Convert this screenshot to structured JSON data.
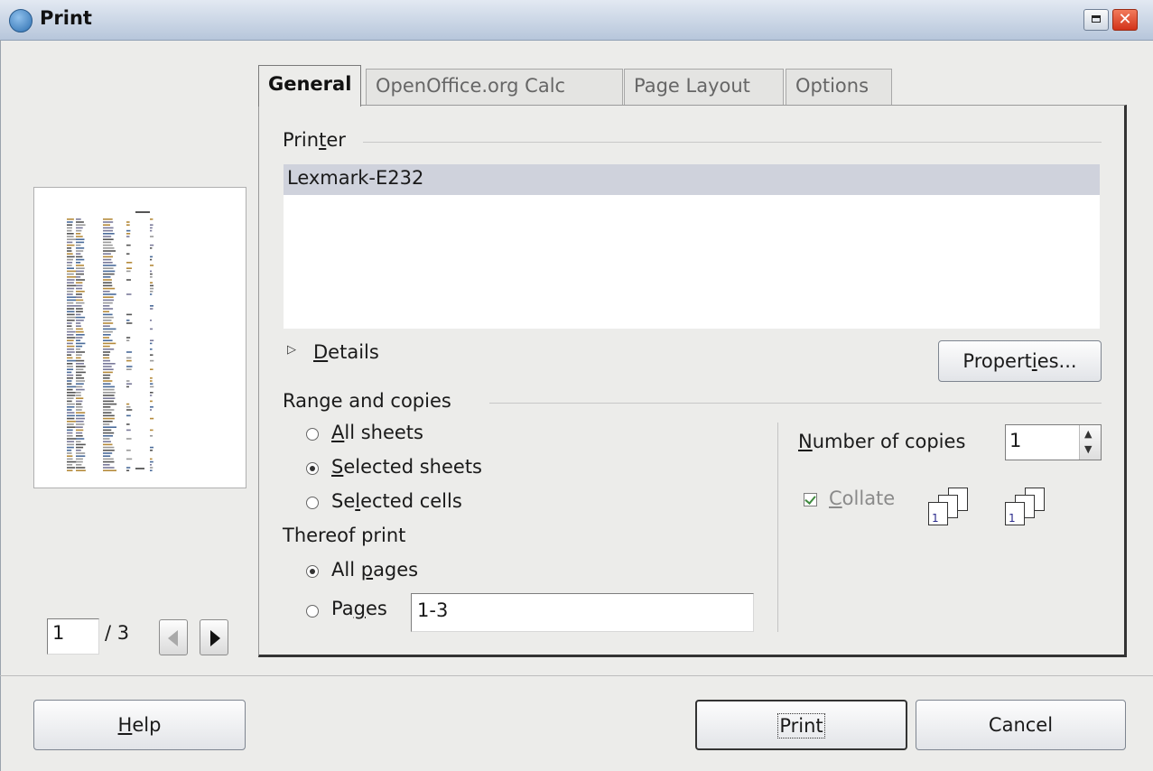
{
  "window": {
    "title": "Print"
  },
  "preview": {
    "current_page": "1",
    "total_pages": "/ 3"
  },
  "tabs": [
    {
      "label": "General",
      "active": true
    },
    {
      "label": "OpenOffice.org Calc",
      "active": false
    },
    {
      "label": "Page Layout",
      "active": false
    },
    {
      "label": "Options",
      "active": false
    }
  ],
  "printer": {
    "label_pre": "Prin",
    "label_ul": "t",
    "label_post": "er",
    "selected": "Lexmark-E232",
    "details_ul": "D",
    "details_rest": "etails",
    "properties_pre": "Propert",
    "properties_ul": "i",
    "properties_post": "es..."
  },
  "range": {
    "heading": "Range and copies",
    "all_sheets_ul": "A",
    "all_sheets_rest": "ll sheets",
    "selected_sheets_ul": "S",
    "selected_sheets_rest": "elected sheets",
    "selected_cells_pre": "Se",
    "selected_cells_ul": "l",
    "selected_cells_post": "ected cells",
    "selected_option": "Selected sheets"
  },
  "thereof": {
    "heading": "Thereof print",
    "all_pages_pre": "All ",
    "all_pages_ul": "p",
    "all_pages_post": "ages",
    "pages_pre": "Pa",
    "pages_ul": "g",
    "pages_post": "es",
    "pages_value": "1-3",
    "selected_option": "All pages"
  },
  "copies": {
    "label_ul": "N",
    "label_rest": "umber of copies",
    "value": "1",
    "collate_ul": "C",
    "collate_rest": "ollate",
    "collate_checked": true
  },
  "buttons": {
    "help_ul": "H",
    "help_rest": "elp",
    "print": "Print",
    "cancel": "Cancel"
  }
}
